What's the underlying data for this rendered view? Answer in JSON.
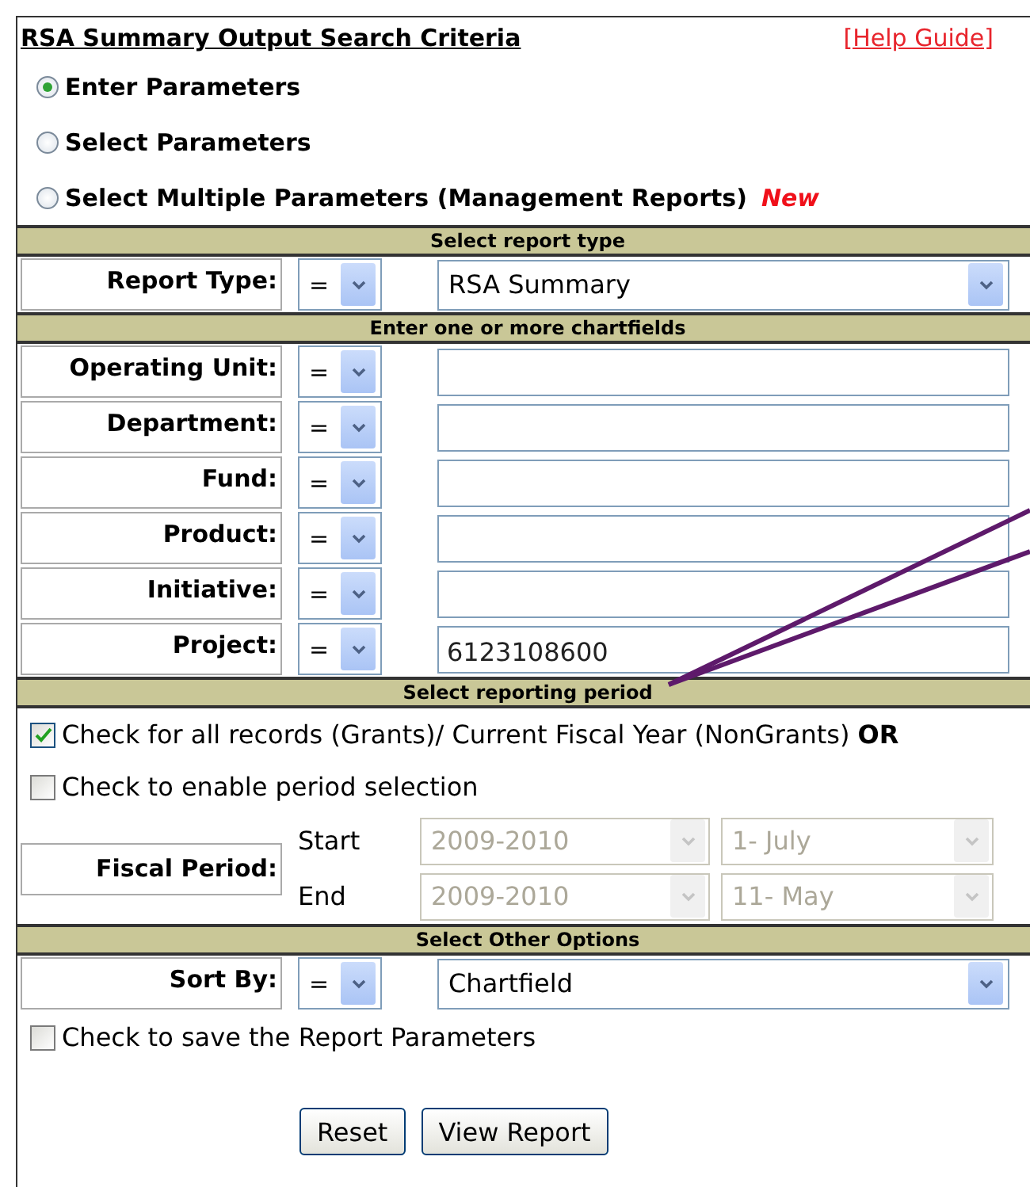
{
  "title": "RSA Summary Output Search Criteria",
  "help_link": "[Help Guide]",
  "modes": [
    {
      "label": "Enter Parameters",
      "selected": true
    },
    {
      "label": "Select Parameters",
      "selected": false
    },
    {
      "label": "Select Multiple Parameters (Management Reports)",
      "badge": "New",
      "selected": false
    }
  ],
  "sections": [
    {
      "heading": "Select report type",
      "rows": [
        {
          "kind": "select",
          "label": "Report Type:",
          "operator": "=",
          "value": "RSA Summary"
        }
      ]
    },
    {
      "heading": "Enter one or more chartfields",
      "rows": [
        {
          "kind": "text",
          "label": "Operating Unit:",
          "operator": "="
        },
        {
          "kind": "text",
          "label": "Department:",
          "operator": "="
        },
        {
          "kind": "text",
          "label": "Fund:",
          "operator": "="
        },
        {
          "kind": "text",
          "label": "Product:",
          "operator": "="
        },
        {
          "kind": "text",
          "label": "Initiative:",
          "operator": "="
        },
        {
          "kind": "text",
          "label": "Project:",
          "operator": "=",
          "value": "6123108600"
        }
      ]
    },
    {
      "heading": "Select reporting period",
      "rows": [
        {
          "kind": "checkbox",
          "label": "Check for all records (Grants)/ Current Fiscal Year (NonGrants)",
          "suffix": "OR",
          "checked": true
        },
        {
          "kind": "checkbox",
          "label": "Check to enable period selection",
          "checked": false
        },
        {
          "kind": "period",
          "label": "Fiscal Period:",
          "lines": [
            {
              "label": "Start",
              "year": "2009-2010",
              "month": "1- July",
              "disabled": true
            },
            {
              "label": "End",
              "year": "2009-2010",
              "month": "11- May",
              "disabled": true
            }
          ]
        }
      ]
    },
    {
      "heading": "Select Other Options",
      "rows": [
        {
          "kind": "select",
          "label": "Sort By:",
          "operator": "=",
          "value": "Chartfield"
        },
        {
          "kind": "checkbox",
          "label": "Check to save the Report Parameters",
          "checked": false
        }
      ]
    }
  ],
  "buttons": [
    "Reset",
    "View Report"
  ]
}
